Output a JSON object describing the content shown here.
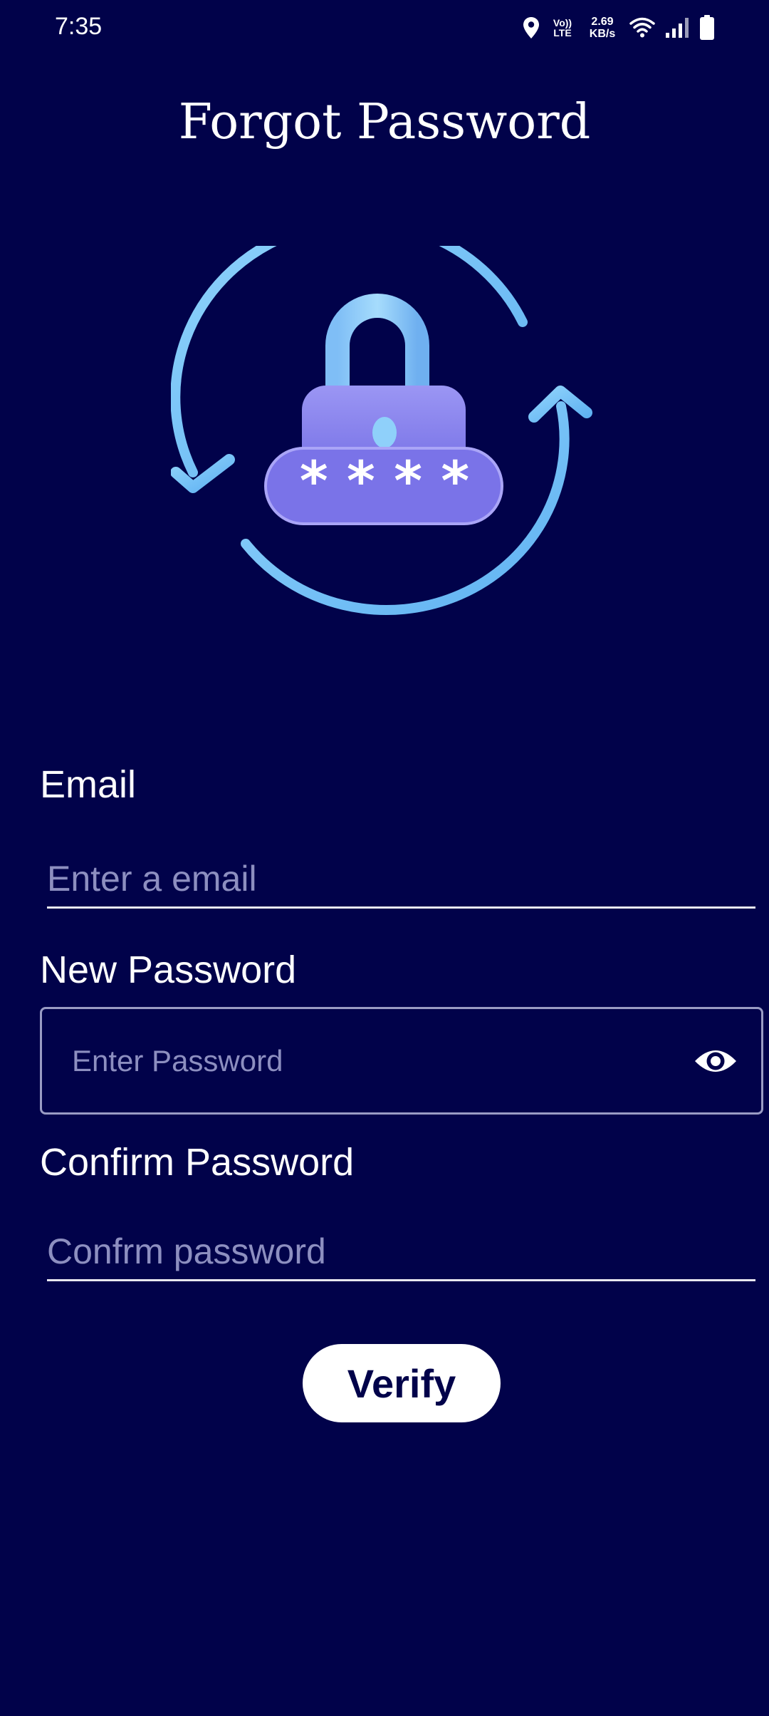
{
  "status_bar": {
    "time": "7:35",
    "lte_line1": "Vo))",
    "lte_line2": "LTE",
    "speed_value": "2.69",
    "speed_unit": "KB/s",
    "icons": [
      "location-icon",
      "volte-icon",
      "wifi-icon",
      "signal-icon",
      "battery-icon"
    ]
  },
  "header": {
    "title": "Forgot Password"
  },
  "illustration": {
    "name": "lock-refresh-illustration",
    "password_mask": "* * * *",
    "colors": {
      "arrow": "#7cc4f8",
      "lock_body": "#8a85ef",
      "lock_shackle": "#8fd0fa"
    }
  },
  "form": {
    "email": {
      "label": "Email",
      "placeholder": "Enter a email"
    },
    "new_password": {
      "label": "New Password",
      "placeholder": "Enter Password",
      "toggle_icon": "eye-icon"
    },
    "confirm_password": {
      "label": "Confirm Password",
      "placeholder": "Confrm password"
    },
    "submit_label": "Verify"
  },
  "colors": {
    "background": "#01024a",
    "button_background": "#ffffff",
    "button_text": "#01024a",
    "placeholder": "#8d8fc0"
  }
}
